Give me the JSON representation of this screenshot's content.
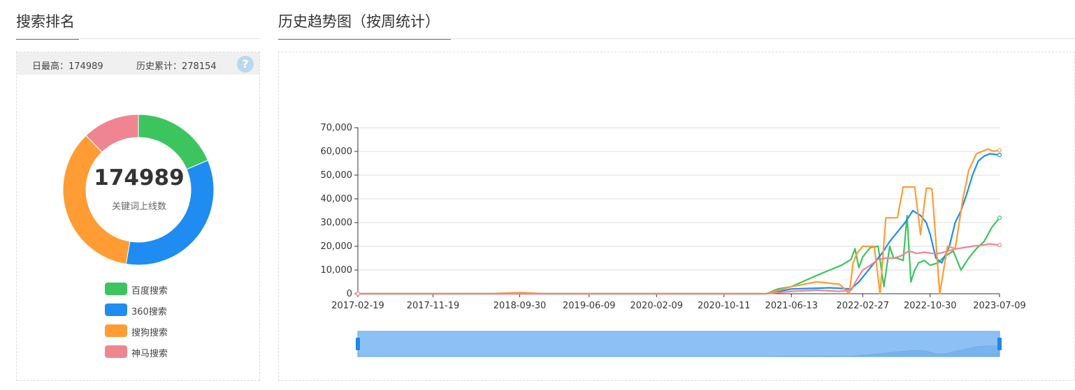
{
  "left": {
    "title": "搜索排名",
    "stats": {
      "daily_max_label": "日最高：174989",
      "total_label": "历史累计：278154"
    },
    "help_icon": "?",
    "donut": {
      "center_value": "174989",
      "center_caption": "关键词上线数"
    },
    "legend": [
      {
        "label": "百度搜索",
        "color": "#3cc55f"
      },
      {
        "label": "360搜索",
        "color": "#1f8cf1"
      },
      {
        "label": "搜狗搜索",
        "color": "#ff9c33"
      },
      {
        "label": "神马搜索",
        "color": "#ef8590"
      }
    ]
  },
  "right": {
    "title": "历史趋势图（按周统计）"
  },
  "chart_data": [
    {
      "type": "pie",
      "categories": [
        "百度搜索",
        "360搜索",
        "搜狗搜索",
        "神马搜索"
      ],
      "values": [
        32000,
        58500,
        60500,
        21000
      ],
      "colors": [
        "#3cc55f",
        "#1f8cf1",
        "#ff9c33",
        "#ef8590"
      ],
      "center_text": "174989"
    },
    {
      "type": "line",
      "xlabel": "",
      "ylabel": "",
      "ylim": [
        0,
        70000
      ],
      "y_ticks": [
        "0",
        "10,000",
        "20,000",
        "30,000",
        "40,000",
        "50,000",
        "60,000",
        "70,000"
      ],
      "y_tick_values": [
        0,
        10000,
        20000,
        30000,
        40000,
        50000,
        60000,
        70000
      ],
      "x_ticks": [
        "2017-02-19",
        "2017-11-19",
        "2018-09-30",
        "2019-06-09",
        "2020-02-09",
        "2020-10-11",
        "2021-06-13",
        "2022-02-27",
        "2022-10-30",
        "2023-07-09"
      ],
      "grid": true,
      "x_range": [
        "2017-02-19",
        "2023-07-09"
      ],
      "series": [
        {
          "name": "百度搜索",
          "color": "#3cc55f",
          "x": [
            "2017-02-19",
            "2021-03-14",
            "2021-04-25",
            "2021-06-13",
            "2021-08-01",
            "2021-09-19",
            "2021-10-31",
            "2021-12-12",
            "2022-01-16",
            "2022-01-30",
            "2022-02-13",
            "2022-02-27",
            "2022-03-27",
            "2022-04-24",
            "2022-05-15",
            "2022-06-05",
            "2022-06-19",
            "2022-07-03",
            "2022-07-24",
            "2022-08-07",
            "2022-08-21",
            "2022-09-04",
            "2022-09-18",
            "2022-10-09",
            "2022-10-30",
            "2022-11-27",
            "2022-12-25",
            "2023-01-22",
            "2023-02-19",
            "2023-03-19",
            "2023-04-16",
            "2023-05-14",
            "2023-06-11",
            "2023-07-09"
          ],
          "y": [
            0,
            0,
            2000,
            3000,
            5500,
            8000,
            10000,
            12000,
            14500,
            19000,
            11000,
            15500,
            19500,
            20000,
            3000,
            20000,
            15000,
            15000,
            14000,
            33000,
            5000,
            10000,
            13000,
            14000,
            12000,
            13000,
            16000,
            18000,
            10000,
            15000,
            19000,
            22000,
            28000,
            32000
          ]
        },
        {
          "name": "360搜索",
          "color": "#1f8cf1",
          "x": [
            "2017-02-19",
            "2021-03-14",
            "2021-06-13",
            "2021-10-31",
            "2022-01-16",
            "2022-02-13",
            "2022-03-13",
            "2022-04-10",
            "2022-05-08",
            "2022-06-05",
            "2022-07-03",
            "2022-07-31",
            "2022-08-28",
            "2022-09-25",
            "2022-10-16",
            "2022-10-30",
            "2022-11-20",
            "2022-12-11",
            "2023-01-08",
            "2023-01-29",
            "2023-02-19",
            "2023-03-12",
            "2023-04-02",
            "2023-04-23",
            "2023-05-14",
            "2023-06-04",
            "2023-07-09"
          ],
          "y": [
            0,
            0,
            2000,
            2500,
            2000,
            5000,
            9000,
            13000,
            17000,
            22000,
            26000,
            30000,
            35000,
            33000,
            30000,
            25000,
            15000,
            13000,
            20000,
            30000,
            35000,
            42000,
            50000,
            56000,
            58000,
            59000,
            58500
          ]
        },
        {
          "name": "搜狗搜索",
          "color": "#ff9c33",
          "x": [
            "2017-02-19",
            "2018-06-03",
            "2018-09-30",
            "2019-01-06",
            "2021-03-14",
            "2021-06-13",
            "2021-09-12",
            "2021-12-05",
            "2022-01-09",
            "2022-01-23",
            "2022-02-06",
            "2022-02-27",
            "2022-03-20",
            "2022-04-10",
            "2022-05-01",
            "2022-05-22",
            "2022-06-12",
            "2022-07-03",
            "2022-07-24",
            "2022-08-14",
            "2022-09-04",
            "2022-09-25",
            "2022-10-16",
            "2022-10-30",
            "2022-11-06",
            "2022-12-04",
            "2023-01-01",
            "2023-01-29",
            "2023-02-26",
            "2023-03-19",
            "2023-04-16",
            "2023-05-07",
            "2023-05-28",
            "2023-06-18",
            "2023-07-09"
          ],
          "y": [
            0,
            0,
            500,
            0,
            0,
            3000,
            5000,
            4000,
            0,
            13000,
            17000,
            20000,
            20000,
            20000,
            0,
            32000,
            32000,
            32000,
            45000,
            45000,
            45000,
            25000,
            44500,
            44500,
            44000,
            0,
            20000,
            19000,
            40000,
            52000,
            59000,
            60000,
            61000,
            60000,
            60500
          ]
        },
        {
          "name": "神马搜索",
          "color": "#ef8590",
          "x": [
            "2017-02-19",
            "2021-03-14",
            "2021-06-13",
            "2021-09-12",
            "2021-12-05",
            "2022-01-16",
            "2022-02-06",
            "2022-02-27",
            "2022-03-27",
            "2022-04-24",
            "2022-05-22",
            "2022-06-19",
            "2022-07-17",
            "2022-08-14",
            "2022-09-11",
            "2022-10-09",
            "2022-11-06",
            "2022-12-04",
            "2023-01-01",
            "2023-02-05",
            "2023-03-05",
            "2023-04-02",
            "2023-05-07",
            "2023-06-04",
            "2023-07-09"
          ],
          "y": [
            0,
            0,
            1000,
            1500,
            1000,
            1500,
            6000,
            10000,
            12000,
            14500,
            15000,
            15000,
            16000,
            18000,
            17000,
            17500,
            17000,
            17000,
            18000,
            19000,
            19500,
            20000,
            20500,
            21000,
            20500
          ]
        }
      ]
    }
  ]
}
